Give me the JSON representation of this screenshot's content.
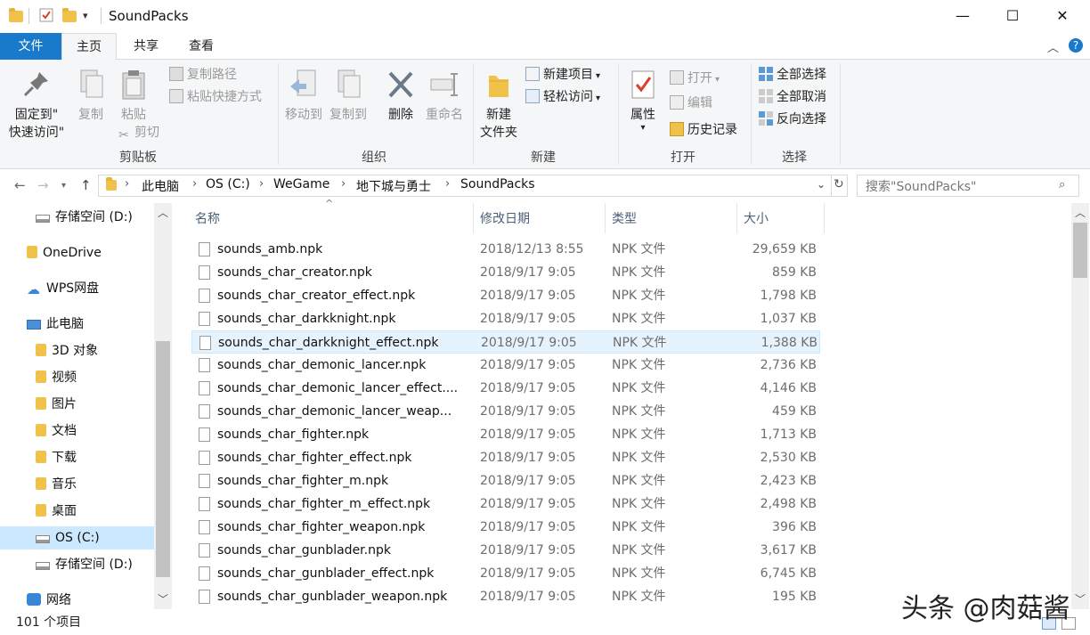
{
  "window": {
    "title": "SoundPacks",
    "controls": {
      "minimize": "—",
      "maximize": "☐",
      "close": "✕"
    }
  },
  "ribbon_tabs": [
    "文件",
    "主页",
    "共享",
    "查看"
  ],
  "ribbon": {
    "clipboard": {
      "label": "剪贴板",
      "pin_line1": "固定到\"",
      "pin_line2": "快速访问\"",
      "copy": "复制",
      "paste": "粘贴",
      "copy_path": "复制路径",
      "paste_shortcut": "粘贴快捷方式",
      "cut": "剪切"
    },
    "organize": {
      "label": "组织",
      "move_to": "移动到",
      "copy_to": "复制到",
      "delete": "删除",
      "rename": "重命名"
    },
    "new": {
      "label": "新建",
      "new_folder_line1": "新建",
      "new_folder_line2": "文件夹",
      "new_item": "新建项目",
      "easy_access": "轻松访问"
    },
    "open": {
      "label": "打开",
      "properties": "属性",
      "open": "打开",
      "edit": "编辑",
      "history": "历史记录"
    },
    "select": {
      "label": "选择",
      "select_all": "全部选择",
      "select_none": "全部取消",
      "invert": "反向选择"
    }
  },
  "breadcrumb": [
    "此电脑",
    "OS (C:)",
    "WeGame",
    "地下城与勇士",
    "SoundPacks"
  ],
  "search": {
    "placeholder": "搜索\"SoundPacks\""
  },
  "nav_pane": [
    {
      "label": "存储空间 (D:)",
      "icon": "drive-icon",
      "indent": 1
    },
    {
      "label": "OneDrive",
      "icon": "folder-icon",
      "indent": 0
    },
    {
      "label": "WPS网盘",
      "icon": "cloud-icon",
      "indent": 0
    },
    {
      "label": "此电脑",
      "icon": "computer-icon",
      "indent": 0
    },
    {
      "label": "3D 对象",
      "icon": "folder-icon",
      "indent": 1
    },
    {
      "label": "视频",
      "icon": "folder-icon",
      "indent": 1
    },
    {
      "label": "图片",
      "icon": "folder-icon",
      "indent": 1
    },
    {
      "label": "文档",
      "icon": "folder-icon",
      "indent": 1
    },
    {
      "label": "下载",
      "icon": "folder-icon",
      "indent": 1
    },
    {
      "label": "音乐",
      "icon": "folder-icon",
      "indent": 1
    },
    {
      "label": "桌面",
      "icon": "folder-icon",
      "indent": 1
    },
    {
      "label": "OS (C:)",
      "icon": "drive-icon",
      "indent": 1,
      "selected": true
    },
    {
      "label": "存储空间 (D:)",
      "icon": "drive-icon",
      "indent": 1
    },
    {
      "label": "网络",
      "icon": "network-icon",
      "indent": 0
    }
  ],
  "columns": {
    "name": "名称",
    "date": "修改日期",
    "type": "类型",
    "size": "大小"
  },
  "files": [
    {
      "name": "sounds_amb.npk",
      "date": "2018/12/13 8:55",
      "type": "NPK 文件",
      "size": "29,659 KB"
    },
    {
      "name": "sounds_char_creator.npk",
      "date": "2018/9/17 9:05",
      "type": "NPK 文件",
      "size": "859 KB"
    },
    {
      "name": "sounds_char_creator_effect.npk",
      "date": "2018/9/17 9:05",
      "type": "NPK 文件",
      "size": "1,798 KB"
    },
    {
      "name": "sounds_char_darkknight.npk",
      "date": "2018/9/17 9:05",
      "type": "NPK 文件",
      "size": "1,037 KB"
    },
    {
      "name": "sounds_char_darkknight_effect.npk",
      "date": "2018/9/17 9:05",
      "type": "NPK 文件",
      "size": "1,388 KB",
      "hover": true
    },
    {
      "name": "sounds_char_demonic_lancer.npk",
      "date": "2018/9/17 9:05",
      "type": "NPK 文件",
      "size": "2,736 KB"
    },
    {
      "name": "sounds_char_demonic_lancer_effect....",
      "date": "2018/9/17 9:05",
      "type": "NPK 文件",
      "size": "4,146 KB"
    },
    {
      "name": "sounds_char_demonic_lancer_weap...",
      "date": "2018/9/17 9:05",
      "type": "NPK 文件",
      "size": "459 KB"
    },
    {
      "name": "sounds_char_fighter.npk",
      "date": "2018/9/17 9:05",
      "type": "NPK 文件",
      "size": "1,713 KB"
    },
    {
      "name": "sounds_char_fighter_effect.npk",
      "date": "2018/9/17 9:05",
      "type": "NPK 文件",
      "size": "2,530 KB"
    },
    {
      "name": "sounds_char_fighter_m.npk",
      "date": "2018/9/17 9:05",
      "type": "NPK 文件",
      "size": "2,423 KB"
    },
    {
      "name": "sounds_char_fighter_m_effect.npk",
      "date": "2018/9/17 9:05",
      "type": "NPK 文件",
      "size": "2,498 KB"
    },
    {
      "name": "sounds_char_fighter_weapon.npk",
      "date": "2018/9/17 9:05",
      "type": "NPK 文件",
      "size": "396 KB"
    },
    {
      "name": "sounds_char_gunblader.npk",
      "date": "2018/9/17 9:05",
      "type": "NPK 文件",
      "size": "3,617 KB"
    },
    {
      "name": "sounds_char_gunblader_effect.npk",
      "date": "2018/9/17 9:05",
      "type": "NPK 文件",
      "size": "6,745 KB"
    },
    {
      "name": "sounds_char_gunblader_weapon.npk",
      "date": "2018/9/17 9:05",
      "type": "NPK 文件",
      "size": "195 KB"
    }
  ],
  "status": {
    "item_count": "101 个项目"
  },
  "watermark": "头条 @肉菇酱",
  "colors": {
    "accent": "#1979ca",
    "hover_row": "#e5f3ff",
    "selected_nav": "#cce8ff",
    "folder": "#f0c24b"
  }
}
